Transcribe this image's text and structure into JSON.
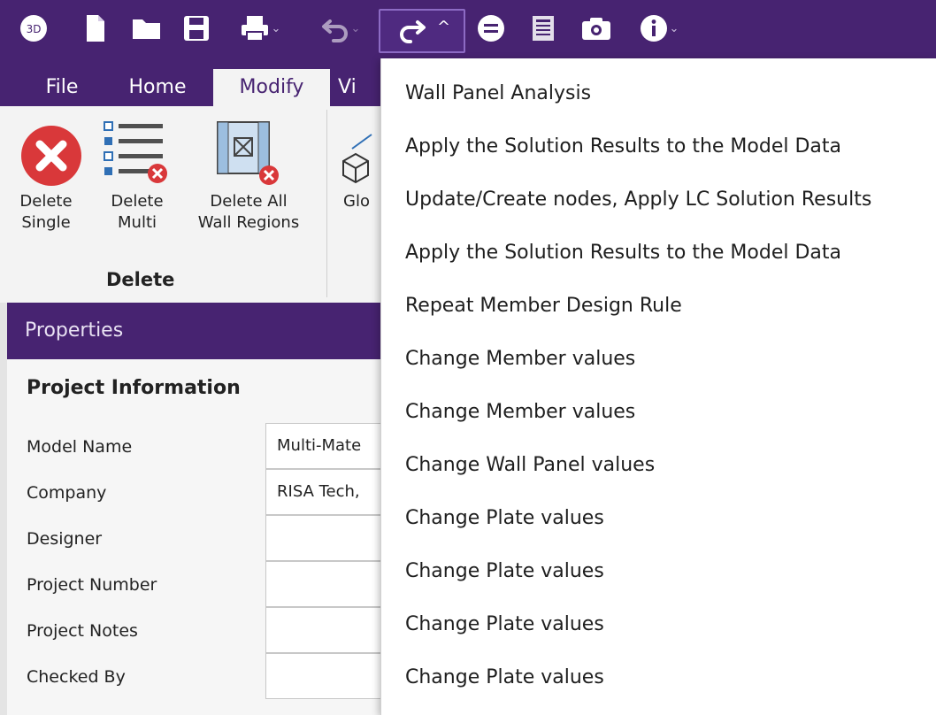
{
  "toolbar": {
    "icons": [
      "3d-icon",
      "new-file-icon",
      "open-folder-icon",
      "save-icon",
      "print-icon",
      "undo-icon",
      "redo-icon",
      "solve-icon",
      "report-icon",
      "camera-icon",
      "info-icon"
    ],
    "badge_3d": "3D"
  },
  "tabs": [
    {
      "label": "File"
    },
    {
      "label": "Home"
    },
    {
      "label": "Modify"
    },
    {
      "label": "Vi"
    }
  ],
  "ribbon": {
    "buttons": [
      {
        "label": "Delete\nSingle"
      },
      {
        "label": "Delete\nMulti"
      },
      {
        "label": "Delete All\nWall Regions"
      },
      {
        "label": "Glo"
      }
    ],
    "group_label": "Delete"
  },
  "properties": {
    "title": "Properties",
    "section": "Project Information",
    "rows": [
      {
        "label": "Model Name",
        "value": "Multi-Mate"
      },
      {
        "label": "Company",
        "value": "RISA Tech,"
      },
      {
        "label": "Designer",
        "value": ""
      },
      {
        "label": "Project Number",
        "value": ""
      },
      {
        "label": "Project Notes",
        "value": ""
      },
      {
        "label": "Checked By",
        "value": ""
      }
    ]
  },
  "redo_menu": {
    "items": [
      "Wall Panel Analysis",
      "Apply the Solution Results to the Model Data",
      "Update/Create nodes, Apply LC Solution Results",
      "Apply the Solution Results to the Model Data",
      "Repeat Member Design Rule",
      "Change Member values",
      "Change Member values",
      "Change Wall Panel values",
      "Change Plate values",
      "Change Plate values",
      "Change Plate values",
      "Change Plate values"
    ]
  },
  "colors": {
    "accent": "#472371",
    "delete_red": "#d9383a",
    "icon_blue": "#2f6fb5"
  }
}
